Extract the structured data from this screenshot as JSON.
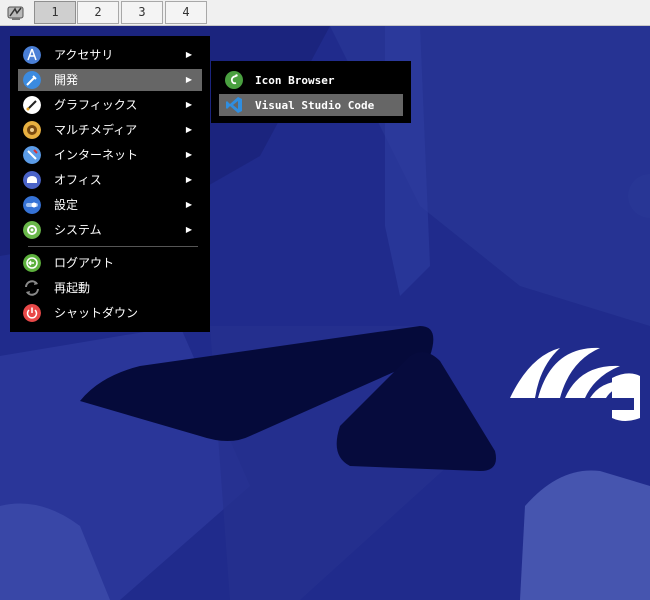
{
  "taskbar": {
    "workspaces": [
      "1",
      "2",
      "3",
      "4"
    ],
    "active_workspace": "1"
  },
  "menu": {
    "items": [
      {
        "label": "アクセサリ",
        "icon": "accessories-icon",
        "submenu": true
      },
      {
        "label": "開発",
        "icon": "development-icon",
        "submenu": true,
        "selected": true
      },
      {
        "label": "グラフィックス",
        "icon": "graphics-icon",
        "submenu": true
      },
      {
        "label": "マルチメディア",
        "icon": "multimedia-icon",
        "submenu": true
      },
      {
        "label": "インターネット",
        "icon": "internet-icon",
        "submenu": true
      },
      {
        "label": "オフィス",
        "icon": "office-icon",
        "submenu": true
      },
      {
        "label": "設定",
        "icon": "settings-icon",
        "submenu": true
      },
      {
        "label": "システム",
        "icon": "system-icon",
        "submenu": true
      }
    ],
    "actions": [
      {
        "label": "ログアウト",
        "icon": "logout-icon"
      },
      {
        "label": "再起動",
        "icon": "restart-icon"
      },
      {
        "label": "シャットダウン",
        "icon": "shutdown-icon"
      }
    ],
    "arrow": "▶"
  },
  "submenu": {
    "items": [
      {
        "label": "Icon Browser",
        "icon": "icon-browser-icon"
      },
      {
        "label": "Visual Studio Code",
        "icon": "vscode-icon",
        "selected": true
      }
    ]
  },
  "colors": {
    "wallpaper": "#1f2a8a",
    "menu_bg": "#000000",
    "selected_bg": "#666666"
  }
}
